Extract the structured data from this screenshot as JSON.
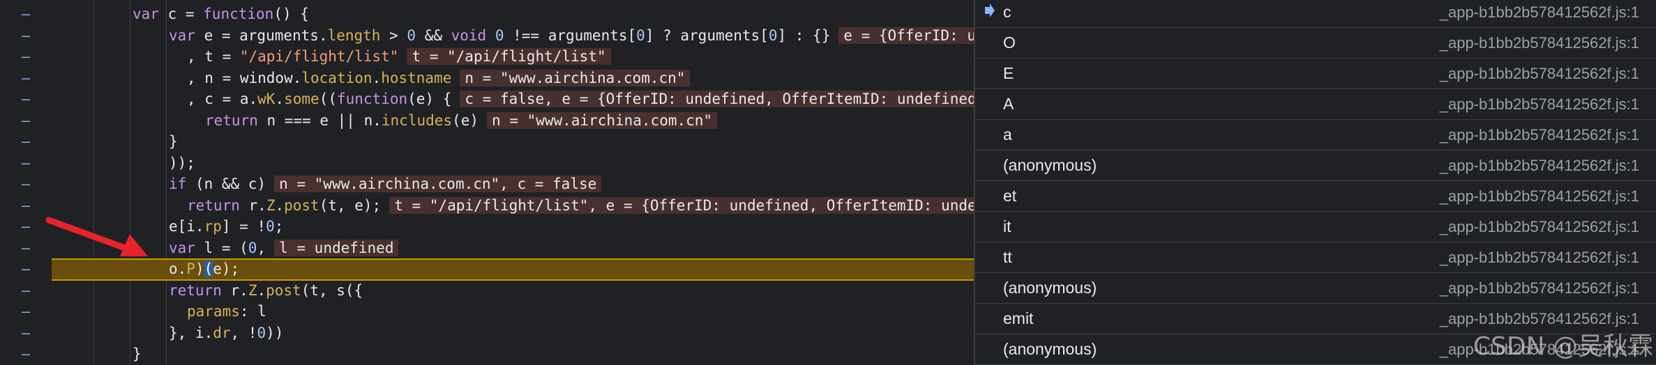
{
  "code": {
    "lines": [
      {
        "indent": 0,
        "segments": [
          {
            "t": "var ",
            "c": "kw"
          },
          {
            "t": "c = "
          },
          {
            "t": "function",
            "c": "kw"
          },
          {
            "t": "() {"
          }
        ]
      },
      {
        "indent": 1,
        "segments": [
          {
            "t": "var ",
            "c": "kw"
          },
          {
            "t": "e = arguments."
          },
          {
            "t": "length",
            "c": "prop"
          },
          {
            "t": " > "
          },
          {
            "t": "0",
            "c": "num"
          },
          {
            "t": " && "
          },
          {
            "t": "void ",
            "c": "kw"
          },
          {
            "t": "0",
            "c": "num"
          },
          {
            "t": " !== arguments["
          },
          {
            "t": "0",
            "c": "num"
          },
          {
            "t": "] ? arguments["
          },
          {
            "t": "0",
            "c": "num"
          },
          {
            "t": "] : {}"
          }
        ],
        "inline": "e = {OfferID: undefined, OfferItemID: undefined"
      },
      {
        "indent": 2,
        "segments": [
          {
            "t": ", t = "
          },
          {
            "t": "\"/api/flight/list\"",
            "c": "str"
          }
        ],
        "inline": "t = \"/api/flight/list\""
      },
      {
        "indent": 2,
        "segments": [
          {
            "t": ", n = window."
          },
          {
            "t": "location",
            "c": "prop"
          },
          {
            "t": "."
          },
          {
            "t": "hostname",
            "c": "prop"
          }
        ],
        "inline": "n = \"www.airchina.com.cn\""
      },
      {
        "indent": 2,
        "segments": [
          {
            "t": ", c = a."
          },
          {
            "t": "wK",
            "c": "prop"
          },
          {
            "t": "."
          },
          {
            "t": "some",
            "c": "fn"
          },
          {
            "t": "(("
          },
          {
            "t": "function",
            "c": "kw"
          },
          {
            "t": "(e) {"
          }
        ],
        "inline": "c = false, e = {OfferID: undefined, OfferItemID: undefined"
      },
      {
        "indent": 3,
        "segments": [
          {
            "t": "return ",
            "c": "kw"
          },
          {
            "t": "n === e || n."
          },
          {
            "t": "includes",
            "c": "fn"
          },
          {
            "t": "(e)"
          }
        ],
        "inline": "n = \"www.airchina.com.cn\""
      },
      {
        "indent": 1,
        "segments": [
          {
            "t": "}"
          }
        ]
      },
      {
        "indent": 1,
        "segments": [
          {
            "t": "));"
          }
        ]
      },
      {
        "indent": 1,
        "segments": [
          {
            "t": "if ",
            "c": "kw"
          },
          {
            "t": "(n && c)"
          }
        ],
        "inline": "n = \"www.airchina.com.cn\", c = false"
      },
      {
        "indent": 2,
        "segments": [
          {
            "t": "return ",
            "c": "kw"
          },
          {
            "t": "r."
          },
          {
            "t": "Z",
            "c": "prop"
          },
          {
            "t": "."
          },
          {
            "t": "post",
            "c": "fn"
          },
          {
            "t": "(t, e);"
          }
        ],
        "inline": "t = \"/api/flight/list\", e = {OfferID: undefined, OfferItemID: undefined"
      },
      {
        "indent": 1,
        "segments": [
          {
            "t": "e[i."
          },
          {
            "t": "rp",
            "c": "prop"
          },
          {
            "t": "] = !"
          },
          {
            "t": "0",
            "c": "num"
          },
          {
            "t": ";"
          }
        ]
      },
      {
        "indent": 1,
        "segments": [
          {
            "t": "var ",
            "c": "kw"
          },
          {
            "t": "l = ("
          },
          {
            "t": "0",
            "c": "num"
          },
          {
            "t": ","
          }
        ],
        "inline": "l = undefined"
      },
      {
        "indent": 1,
        "segments": [
          {
            "t": "o."
          },
          {
            "t": "P",
            "c": "prop"
          },
          {
            "t": ")"
          },
          {
            "t": "(",
            "c": "exec"
          },
          {
            "t": "e);"
          }
        ]
      },
      {
        "indent": 1,
        "segments": [
          {
            "t": "return ",
            "c": "kw"
          },
          {
            "t": "r."
          },
          {
            "t": "Z",
            "c": "prop"
          },
          {
            "t": "."
          },
          {
            "t": "post",
            "c": "fn"
          },
          {
            "t": "(t, s({"
          }
        ]
      },
      {
        "indent": 2,
        "segments": [
          {
            "t": "params",
            "c": "prop"
          },
          {
            "t": ": l"
          }
        ]
      },
      {
        "indent": 1,
        "segments": [
          {
            "t": "}, i."
          },
          {
            "t": "dr",
            "c": "prop"
          },
          {
            "t": ", !"
          },
          {
            "t": "0",
            "c": "num"
          },
          {
            "t": "))"
          }
        ]
      },
      {
        "indent": 0,
        "segments": [
          {
            "t": "}"
          }
        ]
      }
    ],
    "gutter_marker": "–",
    "paused_line_index": 12
  },
  "call_stack": {
    "frames": [
      {
        "name": "c",
        "location": "_app-b1bb2b578412562f.js:1",
        "current": true
      },
      {
        "name": "O",
        "location": "_app-b1bb2b578412562f.js:1"
      },
      {
        "name": "E",
        "location": "_app-b1bb2b578412562f.js:1"
      },
      {
        "name": "A",
        "location": "_app-b1bb2b578412562f.js:1"
      },
      {
        "name": "a",
        "location": "_app-b1bb2b578412562f.js:1"
      },
      {
        "name": "(anonymous)",
        "location": "_app-b1bb2b578412562f.js:1"
      },
      {
        "name": "et",
        "location": "_app-b1bb2b578412562f.js:1"
      },
      {
        "name": "it",
        "location": "_app-b1bb2b578412562f.js:1"
      },
      {
        "name": "tt",
        "location": "_app-b1bb2b578412562f.js:1"
      },
      {
        "name": "(anonymous)",
        "location": "_app-b1bb2b578412562f.js:1"
      },
      {
        "name": "emit",
        "location": "_app-b1bb2b578412562f.js:1"
      },
      {
        "name": "(anonymous)",
        "location": "_app-b1bb2b578412562f.js:1"
      }
    ]
  },
  "watermark": "CSDN @吴秋霖",
  "colors": {
    "annotation_arrow": "#e8232a",
    "paused_line": "#6a4e0c",
    "current_frame_arrow": "#8ab4f8"
  }
}
